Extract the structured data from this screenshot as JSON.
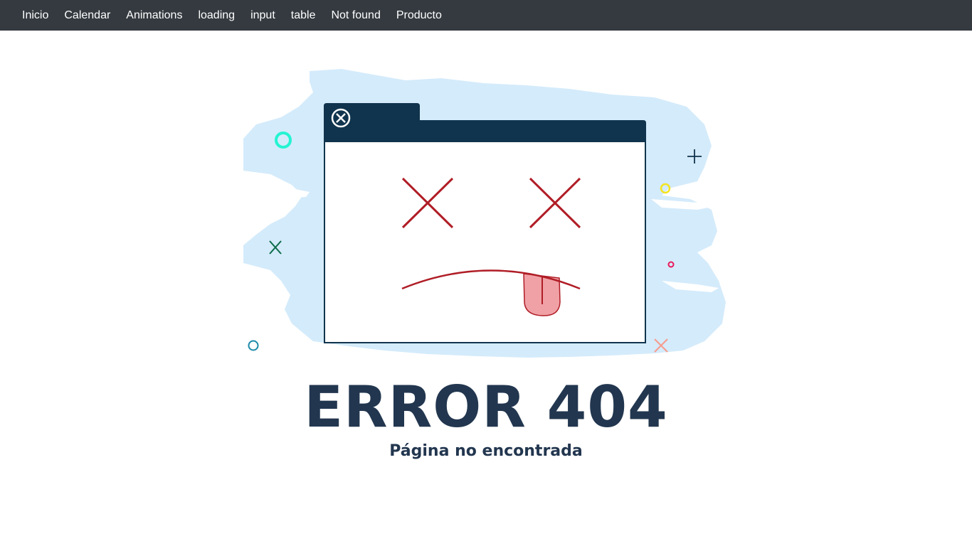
{
  "navbar": {
    "links": [
      "Inicio",
      "Calendar",
      "Animations",
      "loading",
      "input",
      "table",
      "Not found",
      "Producto"
    ]
  },
  "illustration": {
    "icons": [
      "close-circle-icon",
      "dead-eye-x-icon",
      "sad-mouth-icon",
      "tongue-icon",
      "circle-icon",
      "plus-icon",
      "x-icon"
    ],
    "colors": {
      "splash": "#d4ebfb",
      "window_frame": "#10344d",
      "eyes": "#b01d26",
      "tongue": "#f0a1a6",
      "teal_circle": "#24f4d2",
      "yellow_circle": "#f3e420",
      "pink_circle": "#e9185a",
      "blue_circle": "#1c8aa9",
      "green_x": "#0d6b4a",
      "salmon_x": "#f79b8c"
    }
  },
  "error": {
    "title": "ERROR 404",
    "subtitle": "Página no encontrada"
  }
}
